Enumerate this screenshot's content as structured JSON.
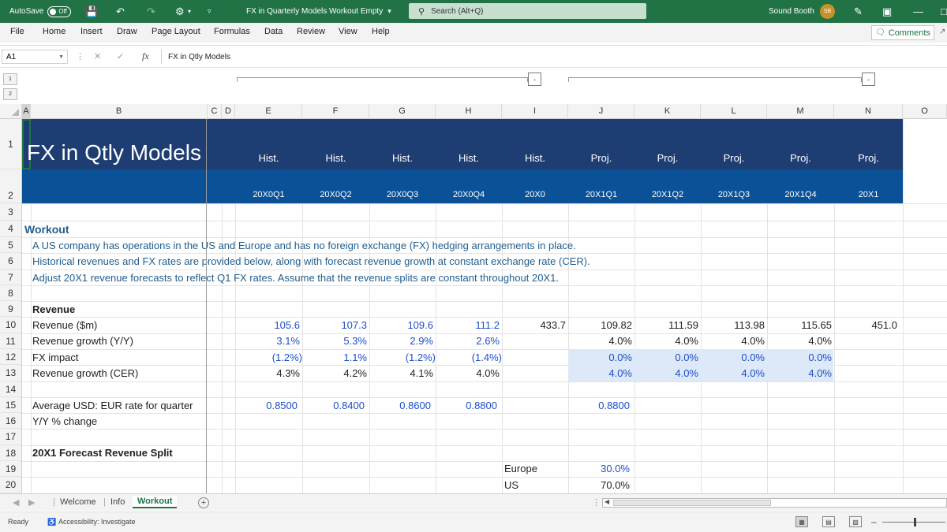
{
  "titlebar": {
    "autosave_label": "AutoSave",
    "autosave_state": "Off",
    "doc_title": "FX in Quarterly Models Workout Empty",
    "doc_title_caret": "▾",
    "search_placeholder": "Search (Alt+Q)",
    "user_name": "Sound Booth",
    "user_initials": "SB",
    "color_bar": "#217346"
  },
  "menubar": {
    "items": [
      "File",
      "Home",
      "Insert",
      "Draw",
      "Page Layout",
      "Formulas",
      "Data",
      "Review",
      "View",
      "Help"
    ],
    "comments_label": "Comments"
  },
  "formulabar": {
    "name_box": "A1",
    "fx_label": "fx",
    "value": "FX in Qtly Models"
  },
  "outline": {
    "levels": [
      "1",
      "2"
    ],
    "collapse_label": "-"
  },
  "columns": [
    "A",
    "B",
    "C",
    "D",
    "E",
    "F",
    "G",
    "H",
    "I",
    "J",
    "K",
    "L",
    "M",
    "N",
    "O"
  ],
  "rows": [
    "1",
    "2",
    "3",
    "4",
    "5",
    "6",
    "7",
    "8",
    "9",
    "10",
    "11",
    "12",
    "13",
    "14",
    "15",
    "16",
    "17",
    "18",
    "19",
    "20"
  ],
  "sheet": {
    "title": "FX in Qtly Models",
    "period_types": [
      "Hist.",
      "Hist.",
      "Hist.",
      "Hist.",
      "Hist.",
      "Proj.",
      "Proj.",
      "Proj.",
      "Proj.",
      "Proj."
    ],
    "periods": [
      "20X0Q1",
      "20X0Q2",
      "20X0Q3",
      "20X0Q4",
      "20X0",
      "20X1Q1",
      "20X1Q2",
      "20X1Q3",
      "20X1Q4",
      "20X1"
    ],
    "workout_heading": "Workout",
    "instructions": [
      "A US company has operations in the US and Europe and has no foreign exchange (FX) hedging arrangements in place.",
      "Historical revenues and FX rates are provided below, along with forecast revenue growth at constant exchange rate (CER).",
      "Adjust 20X1 revenue forecasts to reflect Q1 FX rates. Assume that the revenue splits are constant throughout 20X1."
    ],
    "revenue_heading": "Revenue",
    "labels": {
      "revenue": "Revenue ($m)",
      "growth": "Revenue growth (Y/Y)",
      "fx_impact": "FX impact",
      "growth_cer": "Revenue growth (CER)",
      "fx_rate": "Average USD: EUR rate for quarter",
      "yy_change": "Y/Y % change",
      "split_heading": "20X1 Forecast Revenue Split",
      "europe": "Europe",
      "us": "US"
    },
    "revenue": [
      "105.6",
      "107.3",
      "109.6",
      "111.2",
      "433.7",
      "109.82",
      "111.59",
      "113.98",
      "115.65",
      "451.0"
    ],
    "growth": [
      "3.1%",
      "5.3%",
      "2.9%",
      "2.6%",
      "",
      "4.0%",
      "4.0%",
      "4.0%",
      "4.0%",
      ""
    ],
    "fx_impact": [
      "(1.2%)",
      "1.1%",
      "(1.2%)",
      "(1.4%)",
      "",
      "0.0%",
      "0.0%",
      "0.0%",
      "0.0%",
      ""
    ],
    "growth_cer": [
      "4.3%",
      "4.2%",
      "4.1%",
      "4.0%",
      "",
      "4.0%",
      "4.0%",
      "4.0%",
      "4.0%",
      ""
    ],
    "fx_rate": [
      "0.8500",
      "0.8400",
      "0.8600",
      "0.8800",
      "",
      "0.8800",
      "",
      "",
      "",
      ""
    ],
    "europe_split": "30.0%",
    "us_split": "70.0%",
    "colors": {
      "title_band": "#1e3d72",
      "period_band": "#0a5197",
      "input_blue": "#1f4ec8",
      "text_teal": "#215e8f",
      "input_shade": "#dde9f8"
    }
  },
  "tabs": {
    "items": [
      "Welcome",
      "Info",
      "Workout"
    ],
    "active": "Workout",
    "add": "+"
  },
  "statusbar": {
    "ready": "Ready",
    "accessibility": "Accessibility: Investigate"
  }
}
